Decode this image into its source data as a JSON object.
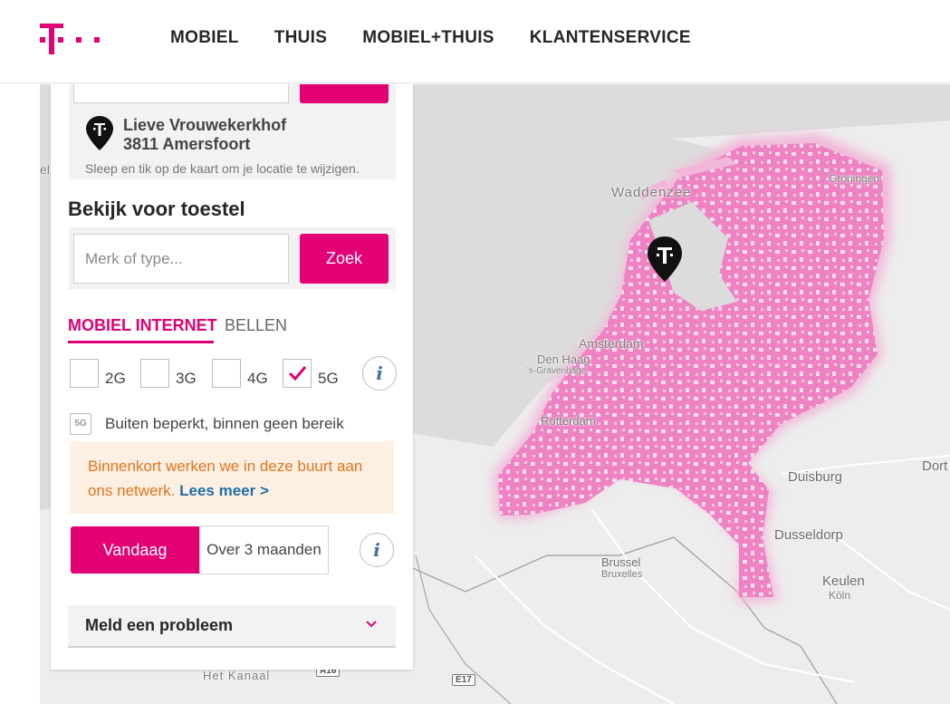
{
  "brand": {
    "accent": "#e20074",
    "logo_icon": "t-logo-icon"
  },
  "nav": {
    "items": [
      {
        "label": "MOBIEL"
      },
      {
        "label": "THUIS"
      },
      {
        "label": "MOBIEL+THUIS"
      },
      {
        "label": "KLANTENSERVICE"
      }
    ]
  },
  "location": {
    "street": "Lieve Vrouwekerkhof",
    "city": "3811 Amersfoort",
    "hint": "Sleep en tik op de kaart om je locatie te wijzigen.",
    "pin_icon": "t-map-pin-icon"
  },
  "device": {
    "title": "Bekijk voor toestel",
    "placeholder": "Merk of type...",
    "search_label": "Zoek"
  },
  "tabs": [
    {
      "label": "MOBIEL INTERNET",
      "active": true
    },
    {
      "label": "BELLEN",
      "active": false
    }
  ],
  "network": {
    "options": [
      {
        "label": "2G",
        "checked": false
      },
      {
        "label": "3G",
        "checked": false
      },
      {
        "label": "4G",
        "checked": false
      },
      {
        "label": "5G",
        "checked": true
      }
    ],
    "info_label": "i"
  },
  "legend": {
    "badge": "5G",
    "text": "Buiten beperkt, binnen geen bereik"
  },
  "notice": {
    "text": "Binnenkort werken we in deze buurt aan ons netwerk. ",
    "link": "Lees meer >"
  },
  "time": {
    "today": "Vandaag",
    "later": "Over 3 maanden",
    "info_label": "i"
  },
  "report": {
    "label": "Meld een probleem",
    "icon": "chevron-down-icon"
  },
  "map": {
    "coverage_color": "#ee7fc0",
    "labels": {
      "waddenzee": "Waddenzee",
      "groningen": "Groningen",
      "amsterdam": "Amsterdam",
      "den_haag": "Den Haag",
      "gravenhage": "'s-Gravenhage",
      "rotterdam": "Rotterdam",
      "duisburg": "Duisburg",
      "dusseldorp": "Dusseldorp",
      "keulen": "Keulen",
      "koln": "Köln",
      "brussel": "Brussel",
      "bruxelles": "Bruxelles",
      "het_kanaal": "Het Kanaal",
      "dort": "Dort",
      "edge_left": "el",
      "a16": "A16",
      "e17": "E17"
    }
  }
}
